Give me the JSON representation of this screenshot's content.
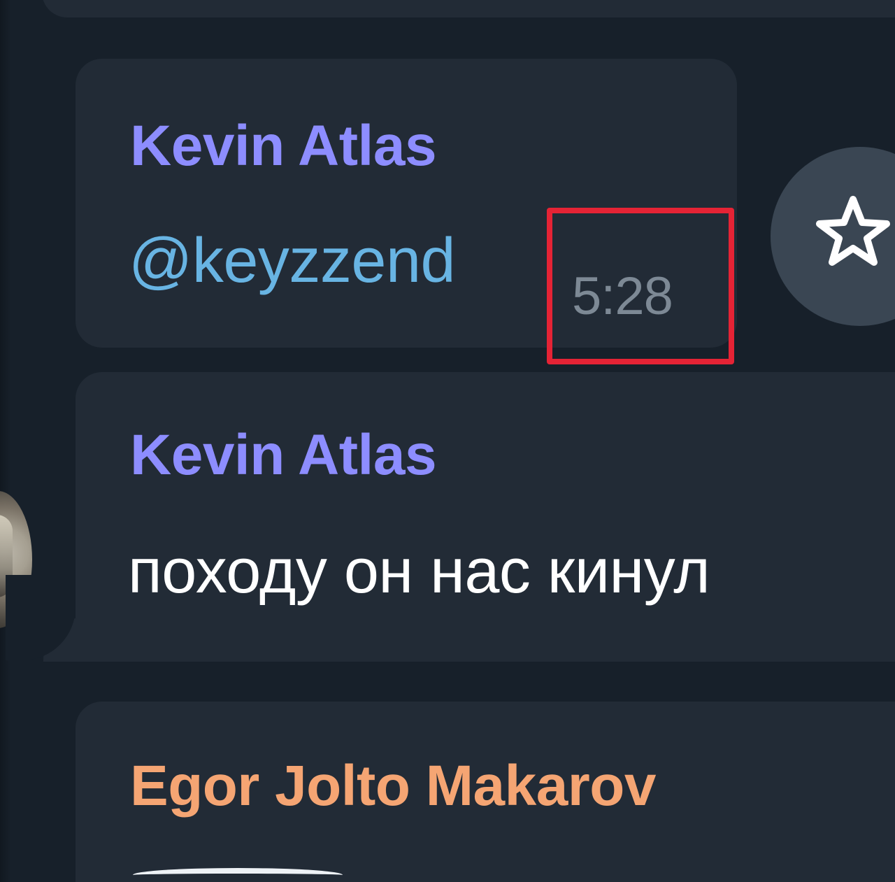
{
  "messages": [
    {
      "sender": "Kevin Atlas",
      "text": "@keyzzend",
      "time": "5:28"
    },
    {
      "sender": "Kevin Atlas",
      "text": "походу он нас кинул"
    },
    {
      "sender": "Egor Jolto Makarov"
    }
  ],
  "icons": {
    "favorite": "star-icon"
  },
  "colors": {
    "background": "#17202a",
    "bubble": "#222b36",
    "kevin_name": "#8d8dff",
    "egor_name": "#f5a573",
    "mention": "#68b4e3",
    "timestamp": "#7d8995",
    "highlight": "#e52335"
  }
}
